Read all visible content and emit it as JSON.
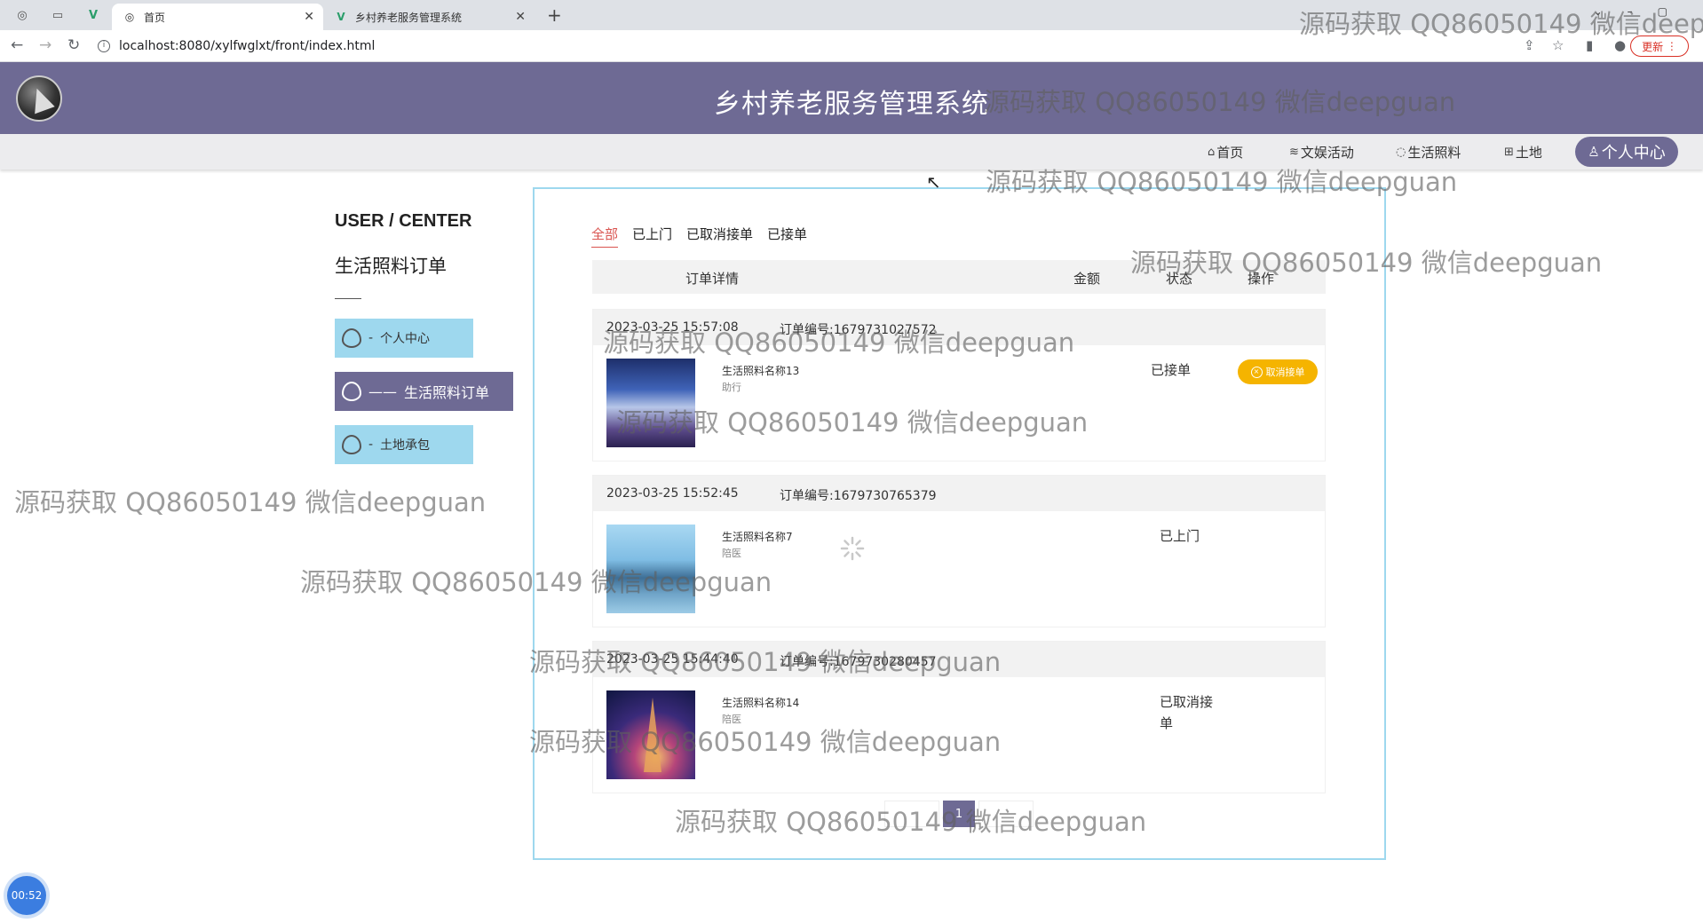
{
  "browser": {
    "tabs": [
      {
        "label": "首页",
        "active": true
      },
      {
        "label": "乡村养老服务管理系统",
        "active": false
      }
    ],
    "url": "localhost:8080/xylfwglxt/front/index.html",
    "update_label": "更新"
  },
  "header": {
    "site_title": "乡村养老服务管理系统"
  },
  "nav": {
    "items": [
      {
        "label": "首页",
        "icon": "home-icon"
      },
      {
        "label": "文娱活动",
        "icon": "hat-icon"
      },
      {
        "label": "生活照料",
        "icon": "palette-icon"
      },
      {
        "label": "土地",
        "icon": "grid-icon"
      }
    ],
    "active": {
      "label": "个人中心",
      "icon": "user-icon"
    }
  },
  "sidebar": {
    "title": "USER / CENTER",
    "subtitle": "生活照料订单",
    "items": [
      {
        "label": "个人中心",
        "prefix": "-",
        "active": false
      },
      {
        "label": "生活照料订单",
        "prefix": "——",
        "active": true
      },
      {
        "label": "土地承包",
        "prefix": "-",
        "active": false
      }
    ]
  },
  "filters": [
    {
      "label": "全部",
      "active": true
    },
    {
      "label": "已上门",
      "active": false
    },
    {
      "label": "已取消接单",
      "active": false
    },
    {
      "label": "已接单",
      "active": false
    }
  ],
  "table_headers": {
    "detail": "订单详情",
    "amount": "金额",
    "status": "状态",
    "op": "操作"
  },
  "orders": [
    {
      "date": "2023-03-25 15:57:08",
      "order_no": "订单编号:1679731027572",
      "name": "生活照料名称13",
      "category": "助行",
      "status": "已接单",
      "action": "取消接单"
    },
    {
      "date": "2023-03-25 15:52:45",
      "order_no": "订单编号:1679730765379",
      "name": "生活照料名称7",
      "category": "陪医",
      "status": "已上门",
      "action": ""
    },
    {
      "date": "2023-03-25 15:44:40",
      "order_no": "订单编号:1679730280457",
      "name": "生活照料名称14",
      "category": "陪医",
      "status": "已取消接单",
      "action": ""
    }
  ],
  "pagination": {
    "current": "1"
  },
  "timer": "00:52",
  "watermark": "源码获取 QQ86050149 微信deepguan",
  "colors": {
    "brand": "#6e6a94",
    "accent_blue": "#9ed8ee",
    "button_orange": "#f5b400",
    "filter_active": "#d9534f"
  }
}
